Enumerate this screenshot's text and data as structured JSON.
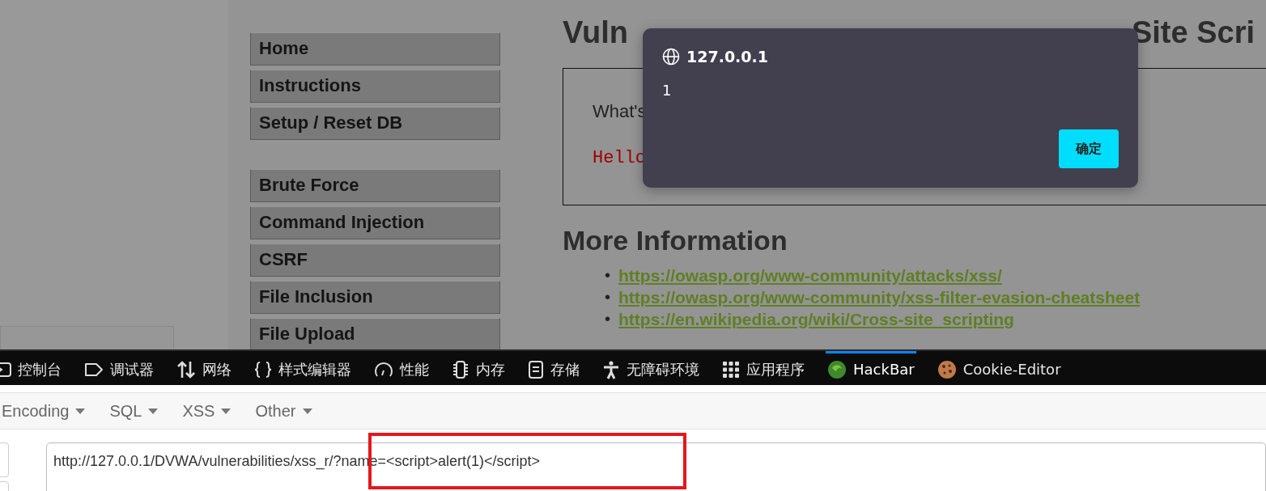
{
  "page": {
    "menu_groups": [
      {
        "items": [
          {
            "label": "Home"
          },
          {
            "label": "Instructions"
          },
          {
            "label": "Setup / Reset DB"
          }
        ]
      },
      {
        "items": [
          {
            "label": "Brute Force"
          },
          {
            "label": "Command Injection"
          },
          {
            "label": "CSRF"
          },
          {
            "label": "File Inclusion"
          },
          {
            "label": "File Upload"
          }
        ]
      }
    ],
    "heading_parts": [
      "Vuln",
      "Site Scri"
    ],
    "prompt": "What's",
    "output": "Hello",
    "more_heading": "More Information",
    "links": [
      {
        "bullet": "•",
        "url": "https://owasp.org/www-community/attacks/xss/"
      },
      {
        "bullet": "•",
        "url": "https://owasp.org/www-community/xss-filter-evasion-cheatsheet"
      },
      {
        "bullet": "•",
        "url": "https://en.wikipedia.org/wiki/Cross-site_scripting"
      }
    ]
  },
  "alert": {
    "origin": "127.0.0.1",
    "message": "1",
    "button": "确定"
  },
  "devtools": {
    "tabs": [
      {
        "label": "控制台",
        "kind": "console",
        "selected": false
      },
      {
        "label": "调试器",
        "kind": "debugger",
        "selected": false
      },
      {
        "label": "网络",
        "kind": "network",
        "selected": false
      },
      {
        "label": "样式编辑器",
        "kind": "braces",
        "selected": false
      },
      {
        "label": "性能",
        "kind": "gauge",
        "selected": false
      },
      {
        "label": "内存",
        "kind": "chip",
        "selected": false
      },
      {
        "label": "存储",
        "kind": "storage",
        "selected": false
      },
      {
        "label": "无障碍环境",
        "kind": "person",
        "selected": false
      },
      {
        "label": "应用程序",
        "kind": "grid",
        "selected": false
      },
      {
        "label": "HackBar",
        "kind": "hackbar",
        "selected": true
      },
      {
        "label": "Cookie-Editor",
        "kind": "cookie",
        "selected": false
      }
    ]
  },
  "hackbar": {
    "menus": [
      "Encoding",
      "SQL",
      "XSS",
      "Other"
    ],
    "url": "http://127.0.0.1/DVWA/vulnerabilities/xss_r/?name=<script>alert(1)</script>"
  }
}
